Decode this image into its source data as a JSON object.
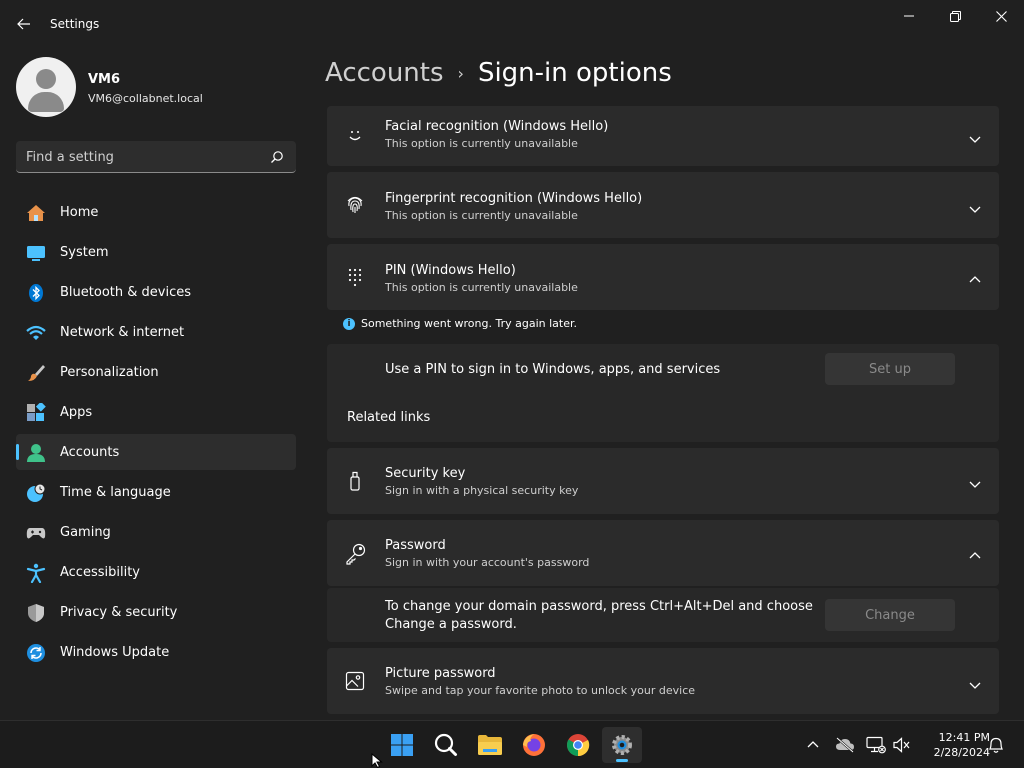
{
  "window": {
    "title": "Settings",
    "back_icon": "back-arrow-icon",
    "minimize_icon": "minimize-icon",
    "maximize_icon": "restore-icon",
    "close_icon": "close-icon"
  },
  "user": {
    "name": "VM6",
    "email": "VM6@collabnet.local"
  },
  "search": {
    "placeholder": "Find a setting"
  },
  "sidebar": {
    "items": [
      {
        "label": "Home",
        "icon": "home-icon"
      },
      {
        "label": "System",
        "icon": "system-icon"
      },
      {
        "label": "Bluetooth & devices",
        "icon": "bluetooth-icon"
      },
      {
        "label": "Network & internet",
        "icon": "wifi-icon"
      },
      {
        "label": "Personalization",
        "icon": "brush-icon"
      },
      {
        "label": "Apps",
        "icon": "apps-icon"
      },
      {
        "label": "Accounts",
        "icon": "accounts-icon",
        "active": true
      },
      {
        "label": "Time & language",
        "icon": "globe-clock-icon"
      },
      {
        "label": "Gaming",
        "icon": "gamepad-icon"
      },
      {
        "label": "Accessibility",
        "icon": "accessibility-icon"
      },
      {
        "label": "Privacy & security",
        "icon": "shield-icon"
      },
      {
        "label": "Windows Update",
        "icon": "update-icon"
      }
    ]
  },
  "breadcrumb": {
    "parent": "Accounts",
    "separator": "›",
    "current": "Sign-in options"
  },
  "options": {
    "facial": {
      "title": "Facial recognition (Windows Hello)",
      "subtitle": "This option is currently unavailable",
      "icon": "face-icon"
    },
    "fingerprint": {
      "title": "Fingerprint recognition (Windows Hello)",
      "subtitle": "This option is currently unavailable",
      "icon": "fingerprint-icon"
    },
    "pin": {
      "title": "PIN (Windows Hello)",
      "subtitle": "This option is currently unavailable",
      "icon": "keypad-icon",
      "error": "Something went wrong. Try again later.",
      "setup_text": "Use a PIN to sign in to Windows, apps, and services",
      "setup_button": "Set up",
      "related_links": "Related links"
    },
    "security_key": {
      "title": "Security key",
      "subtitle": "Sign in with a physical security key",
      "icon": "usb-key-icon"
    },
    "password": {
      "title": "Password",
      "subtitle": "Sign in with your account's password",
      "icon": "key-icon",
      "change_text_1": "To change your domain password, press Ctrl+Alt+Del and choose",
      "change_text_2": "Change a password.",
      "change_button": "Change"
    },
    "picture": {
      "title": "Picture password",
      "subtitle": "Swipe and tap your favorite photo to unlock your device",
      "icon": "picture-icon"
    }
  },
  "taskbar": {
    "apps": [
      "start-icon",
      "search-icon",
      "file-explorer-icon",
      "firefox-icon",
      "chrome-icon",
      "settings-icon"
    ],
    "tray": [
      "chevron-up-icon",
      "cloud-offline-icon",
      "network-icon",
      "volume-muted-icon",
      "notification-bell-icon"
    ],
    "time": "12:41 PM",
    "date": "2/28/2024"
  },
  "colors": {
    "accent": "#4cc2ff",
    "background": "#202020",
    "card": "#2b2b2b"
  }
}
